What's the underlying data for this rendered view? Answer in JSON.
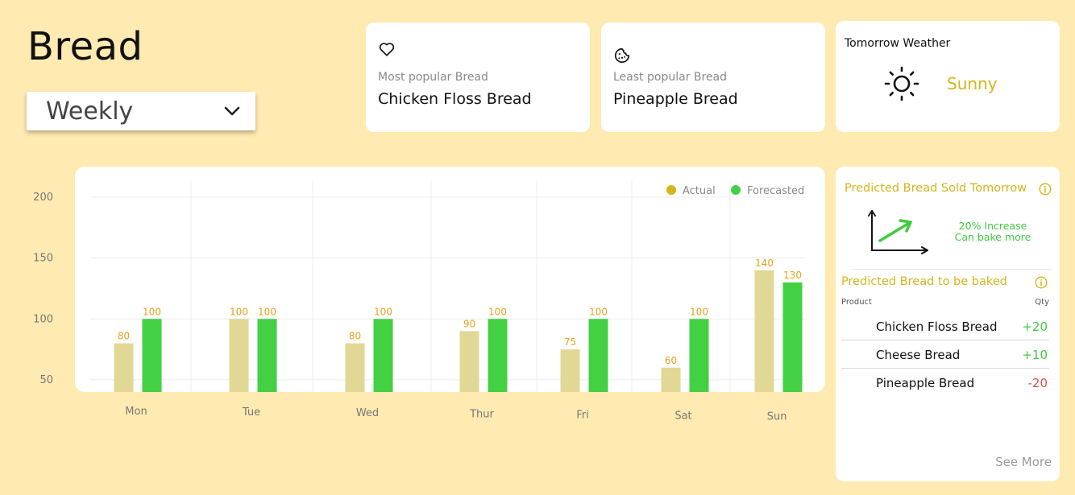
{
  "header": {
    "title": "Bread",
    "period": "Weekly"
  },
  "cards": {
    "most_popular": {
      "label": "Most popular Bread",
      "value": "Chicken Floss Bread",
      "icon": "heart-icon"
    },
    "least_popular": {
      "label": "Least popular Bread",
      "value": "Pineapple Bread",
      "icon": "cookie-icon"
    },
    "weather": {
      "title": "Tomorrow Weather",
      "value": "Sunny",
      "icon": "sun-icon"
    }
  },
  "chart_data": {
    "type": "bar",
    "categories": [
      "Mon",
      "Tue",
      "Wed",
      "Thur",
      "Fri",
      "Sat",
      "Sun"
    ],
    "series": [
      {
        "name": "Actual",
        "values": [
          80,
          100,
          80,
          90,
          75,
          60,
          140
        ],
        "color": "#e1d896"
      },
      {
        "name": "Forecasted",
        "values": [
          100,
          100,
          100,
          100,
          100,
          100,
          130
        ],
        "color": "#43d043"
      }
    ],
    "yticks": [
      50,
      100,
      150,
      200
    ],
    "ylim": [
      40,
      200
    ],
    "grid": true,
    "legend": "top-right",
    "legend_colors": {
      "Actual": "#d4b61a",
      "Forecasted": "#43d043"
    },
    "label_color": "#e6a21c"
  },
  "predicted_sold": {
    "title": "Predicted Bread Sold Tomorrow",
    "line1": "20% Increase",
    "line2": "Can bake more"
  },
  "to_bake": {
    "title": "Predicted Bread to be baked",
    "col_product": "Product",
    "col_qty": "Qty",
    "rows": [
      {
        "name": "Chicken Floss Bread",
        "qty": "+20",
        "color": "#3fcc3f"
      },
      {
        "name": "Cheese Bread",
        "qty": "+10",
        "color": "#3fcc3f"
      },
      {
        "name": "Pineapple Bread",
        "qty": "-20",
        "color": "#d9534f"
      }
    ],
    "see_more": "See More"
  },
  "colors": {
    "background": "#ffeab1",
    "accent_yellow": "#d4b61a",
    "positive": "#3fcc3f",
    "negative": "#d9534f"
  }
}
